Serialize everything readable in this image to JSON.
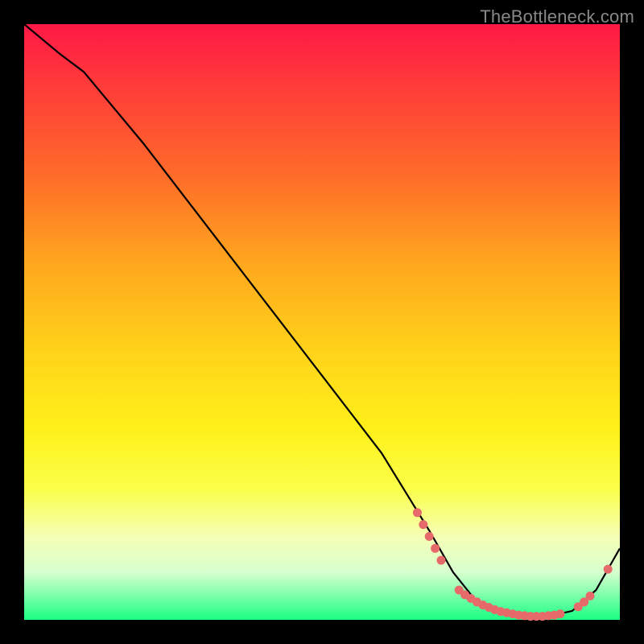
{
  "watermark": "TheBottleneck.com",
  "chart_data": {
    "type": "line",
    "title": "",
    "xlabel": "",
    "ylabel": "",
    "xlim": [
      0,
      100
    ],
    "ylim": [
      0,
      100
    ],
    "series": [
      {
        "name": "curve",
        "x": [
          0,
          6,
          10,
          20,
          30,
          40,
          50,
          60,
          68,
          72,
          76,
          80,
          84,
          88,
          92,
          96,
          100
        ],
        "y": [
          100,
          95,
          92,
          80,
          67,
          54,
          41,
          28,
          15,
          8,
          3,
          1,
          0.5,
          0.6,
          1.5,
          5,
          12
        ]
      }
    ],
    "markers": {
      "name": "dots",
      "x": [
        66,
        67,
        68,
        69,
        70,
        73,
        74,
        75,
        76,
        77,
        78,
        79,
        80,
        81,
        82,
        83,
        84,
        85,
        86,
        87,
        88,
        89,
        90,
        93,
        94,
        95,
        98
      ],
      "y": [
        18,
        16,
        14,
        12,
        10,
        5,
        4.2,
        3.6,
        3.0,
        2.5,
        2.1,
        1.7,
        1.4,
        1.2,
        1.0,
        0.8,
        0.7,
        0.6,
        0.6,
        0.6,
        0.7,
        0.8,
        1.0,
        2.2,
        3.0,
        4.0,
        8.5
      ],
      "color": "#e66a6a"
    },
    "gradient_stops": [
      {
        "pct": 0,
        "color": "#ff1846"
      },
      {
        "pct": 10,
        "color": "#ff3a3a"
      },
      {
        "pct": 25,
        "color": "#ff6a2a"
      },
      {
        "pct": 40,
        "color": "#ffa61e"
      },
      {
        "pct": 55,
        "color": "#ffd31a"
      },
      {
        "pct": 68,
        "color": "#fff01a"
      },
      {
        "pct": 78,
        "color": "#fbff4a"
      },
      {
        "pct": 86,
        "color": "#f5ffb5"
      },
      {
        "pct": 92,
        "color": "#d8ffcf"
      },
      {
        "pct": 100,
        "color": "#1bff84"
      }
    ]
  }
}
